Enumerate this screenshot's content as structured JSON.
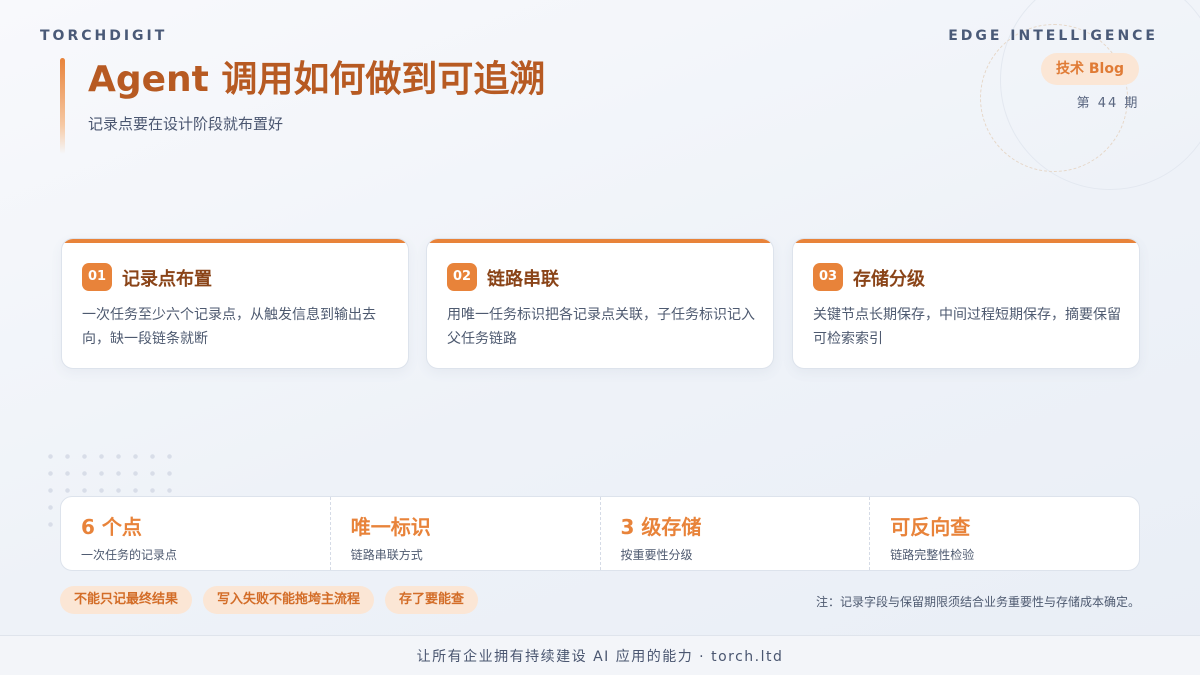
{
  "header": {
    "brand": "TORCHDIGIT",
    "edge_label": "EDGE INTELLIGENCE",
    "blog_pill": "技术 Blog",
    "issue": "第 44 期"
  },
  "hero": {
    "title": "Agent 调用如何做到可追溯",
    "subtitle": "记录点要在设计阶段就布置好"
  },
  "cards": [
    {
      "num": "01",
      "title": "记录点布置",
      "desc": "一次任务至少六个记录点，从触发信息到输出去向，缺一段链条就断"
    },
    {
      "num": "02",
      "title": "链路串联",
      "desc": "用唯一任务标识把各记录点关联，子任务标识记入父任务链路"
    },
    {
      "num": "03",
      "title": "存储分级",
      "desc": "关键节点长期保存，中间过程短期保存，摘要保留可检索索引"
    }
  ],
  "stats": [
    {
      "value": "6 个点",
      "label": "一次任务的记录点"
    },
    {
      "value": "唯一标识",
      "label": "链路串联方式"
    },
    {
      "value": "3 级存储",
      "label": "按重要性分级"
    },
    {
      "value": "可反向查",
      "label": "链路完整性检验"
    }
  ],
  "tags": [
    "不能只记最终结果",
    "写入失败不能拖垮主流程",
    "存了要能查"
  ],
  "note": "注：记录字段与保留期限须结合业务重要性与存储成本确定。",
  "footer": "让所有企业拥有持续建设 AI 应用的能力 · torch.ltd",
  "colors": {
    "accent": "#e8833a",
    "title": "#b75a22",
    "pill_bg": "#fbe6d5"
  }
}
